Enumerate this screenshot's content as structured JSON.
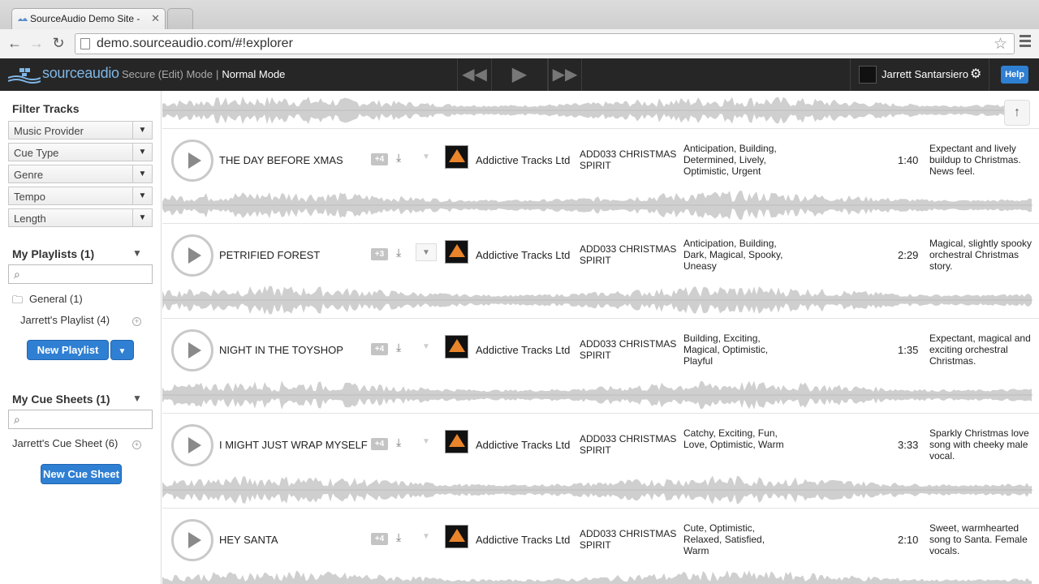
{
  "browser": {
    "tab_title": "SourceAudio Demo Site - ",
    "url": "demo.sourceaudio.com/#!explorer"
  },
  "header": {
    "logo_text": "sourceaudio",
    "secure_mode": "Secure (Edit) Mode",
    "separator": "|",
    "normal_mode": "Normal Mode",
    "user_name": "Jarrett Santarsiero",
    "help_label": "Help"
  },
  "sidebar": {
    "filter_title": "Filter Tracks",
    "filters": [
      "Music Provider",
      "Cue Type",
      "Genre",
      "Tempo",
      "Length"
    ],
    "playlists_title": "My Playlists (1)",
    "playlist_folder": "General (1)",
    "playlist_item": "Jarrett's Playlist (4)",
    "new_playlist_label": "New Playlist",
    "cuesheets_title": "My Cue Sheets (1)",
    "cuesheet_item": "Jarrett's Cue Sheet (6)",
    "new_cuesheet_label": "New Cue Sheet"
  },
  "tracks": [
    {
      "title": "THE DAY BEFORE XMAS",
      "count": "+4",
      "provider": "Addictive Tracks Ltd",
      "album_code": "ADD033 CHRISTMAS SPIRIT",
      "moods": "Anticipation, Building, Determined, Lively, Optimistic, Urgent",
      "duration": "1:40",
      "description": "Expectant and lively buildup to Christmas. News feel.",
      "expanded": false
    },
    {
      "title": "PETRIFIED FOREST",
      "count": "+3",
      "provider": "Addictive Tracks Ltd",
      "album_code": "ADD033 CHRISTMAS SPIRIT",
      "moods": "Anticipation, Building, Dark, Magical, Spooky, Uneasy",
      "duration": "2:29",
      "description": "Magical, slightly spooky orchestral Christmas story.",
      "expanded": true
    },
    {
      "title": "NIGHT IN THE TOYSHOP",
      "count": "+4",
      "provider": "Addictive Tracks Ltd",
      "album_code": "ADD033 CHRISTMAS SPIRIT",
      "moods": "Building, Exciting, Magical, Optimistic, Playful",
      "duration": "1:35",
      "description": "Expectant, magical and exciting orchestral Christmas.",
      "expanded": false
    },
    {
      "title": "I MIGHT JUST WRAP MYSELF",
      "count": "+4",
      "provider": "Addictive Tracks Ltd",
      "album_code": "ADD033 CHRISTMAS SPIRIT",
      "moods": "Catchy, Exciting, Fun, Love, Optimistic, Warm",
      "duration": "3:33",
      "description": "Sparkly Christmas love song with cheeky male vocal.",
      "expanded": false
    },
    {
      "title": "HEY SANTA",
      "count": "+4",
      "provider": "Addictive Tracks Ltd",
      "album_code": "ADD033 CHRISTMAS SPIRIT",
      "moods": "Cute, Optimistic, Relaxed, Satisfied, Warm",
      "duration": "2:10",
      "description": "Sweet, warmhearted song to Santa. Female vocals.",
      "expanded": false
    }
  ],
  "colors": {
    "accent": "#2f7fd3",
    "header_bg": "#262626",
    "waveform": "#cfcfcf"
  }
}
